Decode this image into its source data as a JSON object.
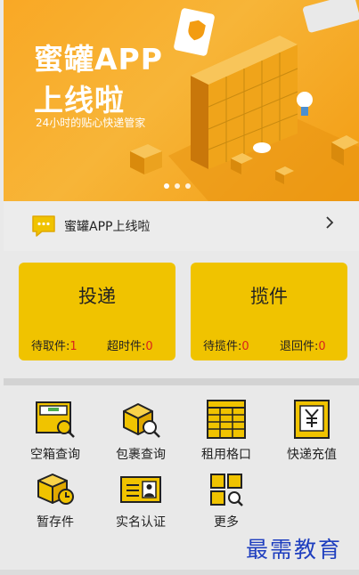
{
  "banner": {
    "title_line1": "蜜罐APP",
    "title_line2": "上线啦",
    "subtitle": "24小时的贴心快递管家",
    "slides": 3,
    "active_slide": 1
  },
  "notice": {
    "text": "蜜罐APP上线啦",
    "icon": "message-icon",
    "chevron": "chevron-right-icon"
  },
  "cards": [
    {
      "title": "投递",
      "stats": [
        {
          "label": "待取件:",
          "value": "1"
        },
        {
          "label": "超时件:",
          "value": "0"
        }
      ]
    },
    {
      "title": "揽件",
      "stats": [
        {
          "label": "待揽件:",
          "value": "0"
        },
        {
          "label": "退回件:",
          "value": "0"
        }
      ]
    }
  ],
  "grid": [
    {
      "label": "空箱查询",
      "icon": "empty-box-search-icon"
    },
    {
      "label": "包裹查询",
      "icon": "parcel-search-icon"
    },
    {
      "label": "租用格口",
      "icon": "locker-rent-icon"
    },
    {
      "label": "快递充值",
      "icon": "yuan-recharge-icon"
    },
    {
      "label": "暂存件",
      "icon": "temporary-storage-icon"
    },
    {
      "label": "实名认证",
      "icon": "id-card-icon"
    },
    {
      "label": "更多",
      "icon": "more-grid-icon"
    }
  ],
  "watermark": "最需教育",
  "colors": {
    "accent": "#f0c300",
    "alert": "#d9231c",
    "banner": "#f7b538"
  }
}
